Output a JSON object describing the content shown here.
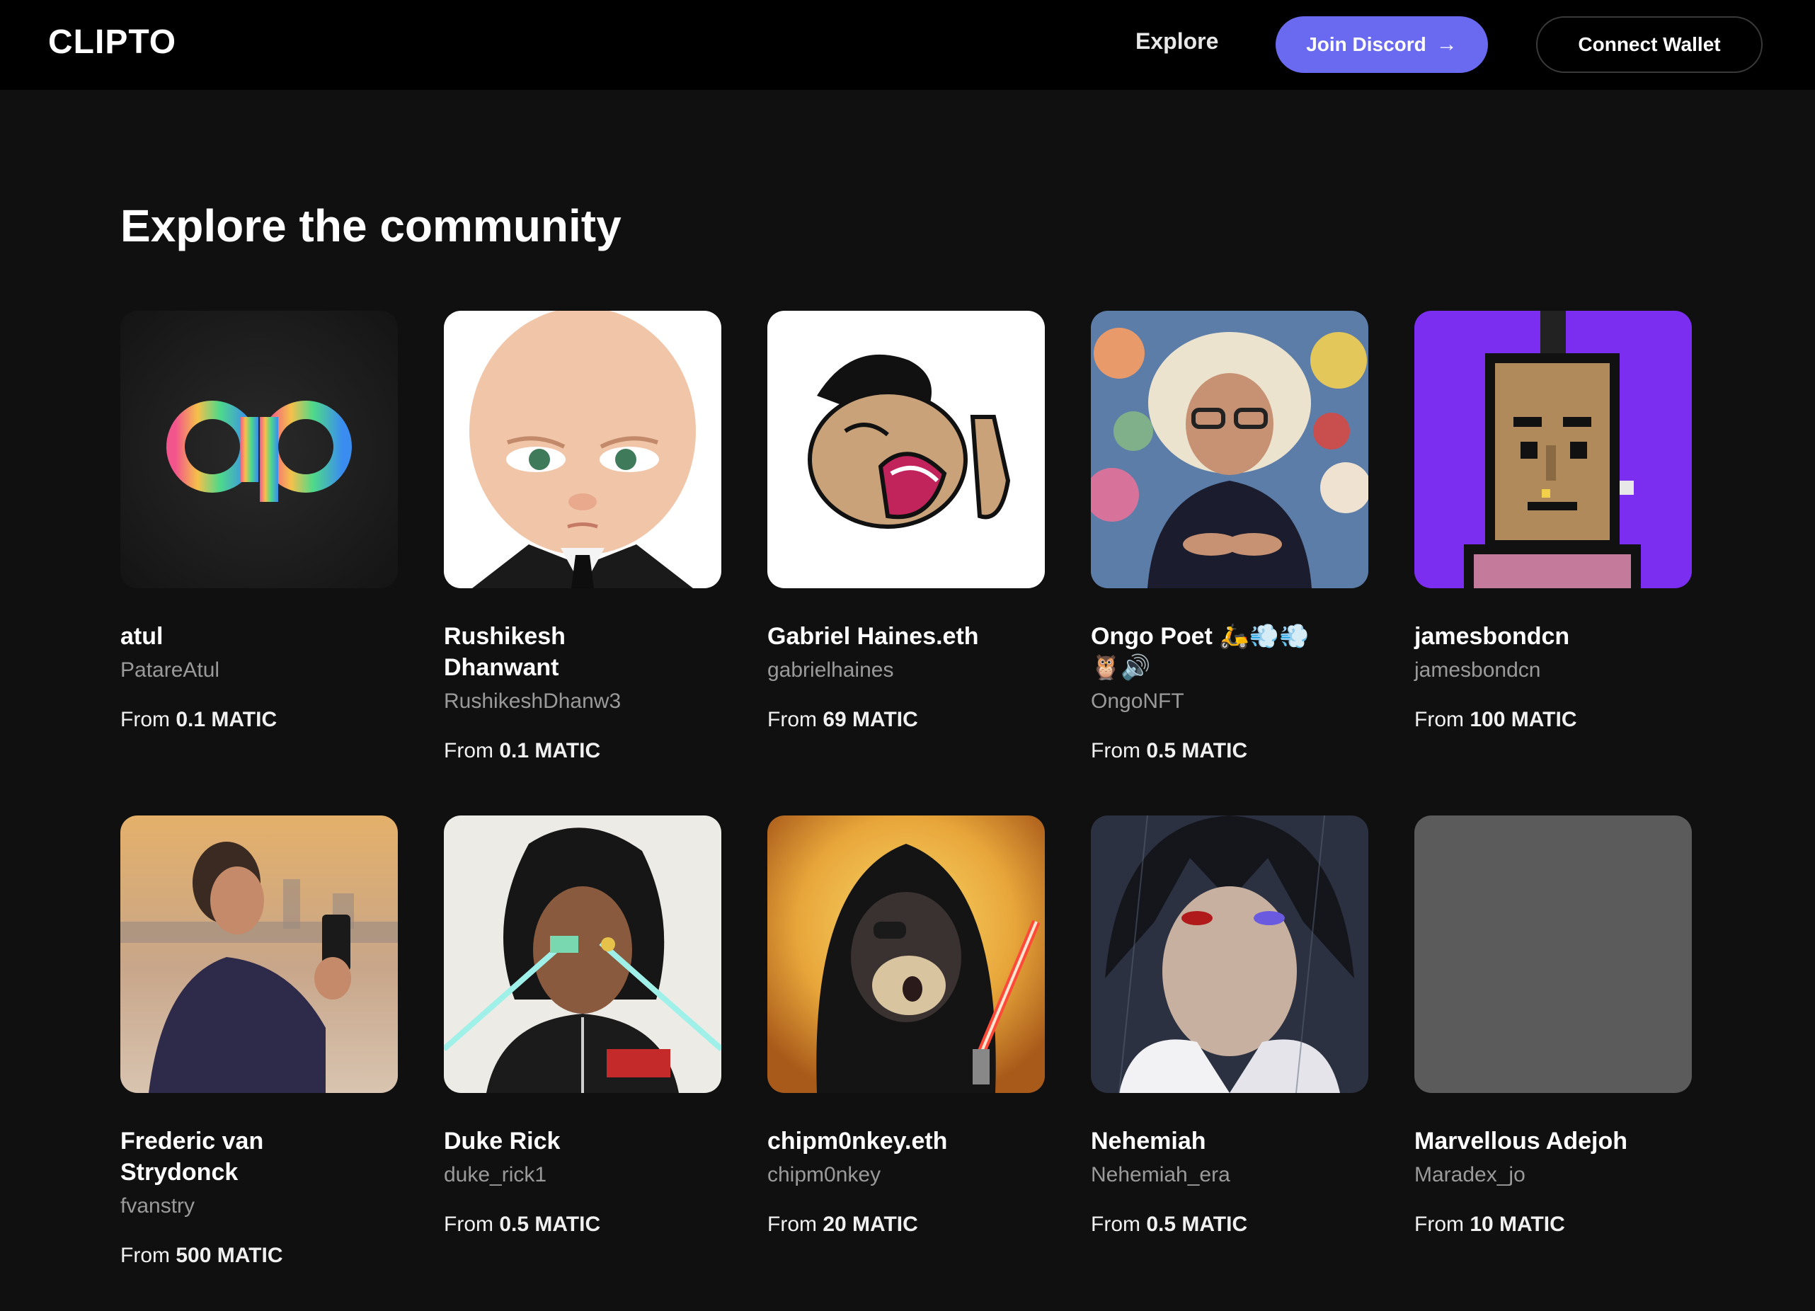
{
  "header": {
    "logo": "CLIPTO",
    "nav_explore": "Explore",
    "discord_label": "Join Discord",
    "discord_icon": "arrow-right-icon",
    "wallet_label": "Connect Wallet"
  },
  "main": {
    "heading": "Explore the community",
    "price_prefix": "From",
    "creators": [
      {
        "name": "atul",
        "handle": "PatareAtul",
        "price": "0.1 MATIC",
        "avatar": "ap-logo"
      },
      {
        "name": "Rushikesh Dhanwant",
        "handle": "RushikeshDhanw3",
        "price": "0.1 MATIC",
        "avatar": "boss-baby"
      },
      {
        "name": "Gabriel Haines.eth",
        "handle": "gabrielhaines",
        "price": "69 MATIC",
        "avatar": "cartoon-face"
      },
      {
        "name": "Ongo Poet 🛵💨💨🦉🔊",
        "handle": "OngoNFT",
        "price": "0.5 MATIC",
        "avatar": "white-wig-portrait"
      },
      {
        "name": "jamesbondcn",
        "handle": "jamesbondcn",
        "price": "100 MATIC",
        "avatar": "pixel-punk"
      },
      {
        "name": "Frederic van Strydonck",
        "handle": "fvanstry",
        "price": "500 MATIC",
        "avatar": "man-with-phone"
      },
      {
        "name": "Duke Rick",
        "handle": "duke_rick1",
        "price": "0.5 MATIC",
        "avatar": "anime-character"
      },
      {
        "name": "chipm0nkey.eth",
        "handle": "chipm0nkey",
        "price": "20 MATIC",
        "avatar": "hooded-ape"
      },
      {
        "name": "Nehemiah",
        "handle": "Nehemiah_era",
        "price": "0.5 MATIC",
        "avatar": "anime-portrait"
      },
      {
        "name": "Marvellous Adejoh",
        "handle": "Maradex_jo",
        "price": "10 MATIC",
        "avatar": "placeholder"
      }
    ]
  },
  "colors": {
    "background": "#101010",
    "header": "#000000",
    "accent": "#6a6af0",
    "muted_text": "#9a9a9a"
  }
}
